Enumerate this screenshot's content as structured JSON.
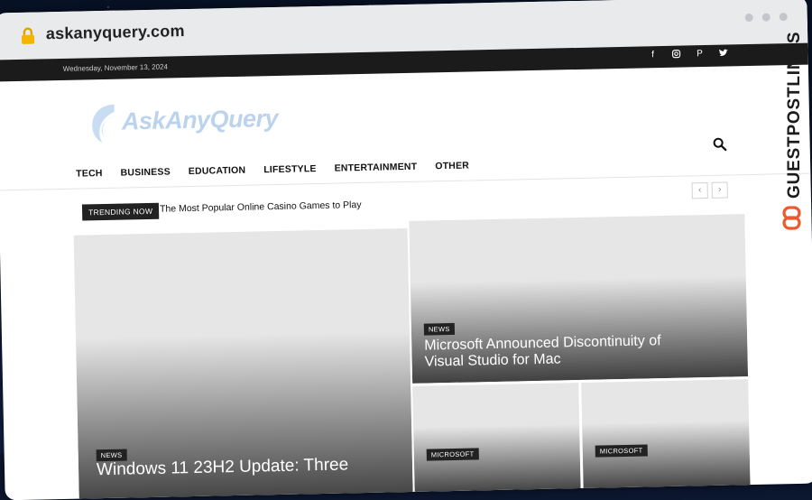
{
  "browser": {
    "url": "askanyquery.com"
  },
  "topbar": {
    "date": "Wednesday, November 13, 2024",
    "social_icons": [
      "facebook-icon",
      "instagram-icon",
      "pinterest-icon",
      "twitter-icon"
    ]
  },
  "logo": {
    "text": "AskAnyQuery"
  },
  "nav": {
    "items": [
      "TECH",
      "BUSINESS",
      "EDUCATION",
      "LIFESTYLE",
      "ENTERTAINMENT",
      "OTHER"
    ]
  },
  "trending": {
    "badge": "TRENDING NOW",
    "headline": "The Most Popular Online Casino Games to Play"
  },
  "cards": {
    "main": {
      "category": "NEWS",
      "title": "Windows 11 23H2 Update: Three"
    },
    "top_right": {
      "category": "NEWS",
      "title_line1": "Microsoft Announced Discontinuity of",
      "title_line2": "Visual Studio for Mac"
    },
    "small_left": {
      "category": "MICROSOFT"
    },
    "small_right": {
      "category": "MICROSOFT"
    }
  },
  "watermark": {
    "text": "GUESTPOSTLINKS"
  },
  "colors": {
    "logo": "#bcd3ee",
    "topbar": "#1b1b1b",
    "chrome": "#e9eaec",
    "lock": "#f4b400"
  }
}
